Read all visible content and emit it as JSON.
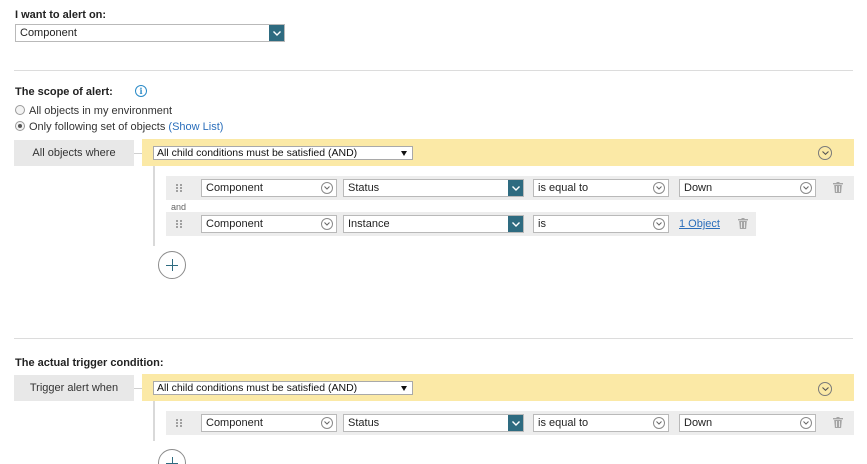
{
  "alert_on": {
    "label": "I want to alert on:",
    "value": "Component"
  },
  "scope": {
    "label": "The scope of alert:",
    "option_all": "All objects in my environment",
    "option_following": "Only following set of objects",
    "show_list": "(Show List)",
    "selected": "following",
    "where_label": "All objects where",
    "group_mode": "All child conditions must be satisfied (AND)",
    "conditions": [
      {
        "entity": "Component",
        "field": "Status",
        "operator": "is equal to",
        "value": "Down"
      },
      {
        "entity": "Component",
        "field": "Instance",
        "operator": "is",
        "value_link": "1 Object"
      }
    ],
    "joiner": "and"
  },
  "trigger": {
    "label": "The actual trigger condition:",
    "when_label": "Trigger alert when",
    "group_mode": "All child conditions must be satisfied (AND)",
    "conditions": [
      {
        "entity": "Component",
        "field": "Status",
        "operator": "is equal to",
        "value": "Down"
      }
    ]
  },
  "colors": {
    "accent_teal": "#2e6b80",
    "link_blue": "#2a6ebb",
    "group_bar_yellow": "#fbe9a6"
  },
  "icons": [
    "info-icon",
    "grip-icon",
    "trash-icon",
    "plus-icon",
    "chevron-down-icon"
  ]
}
